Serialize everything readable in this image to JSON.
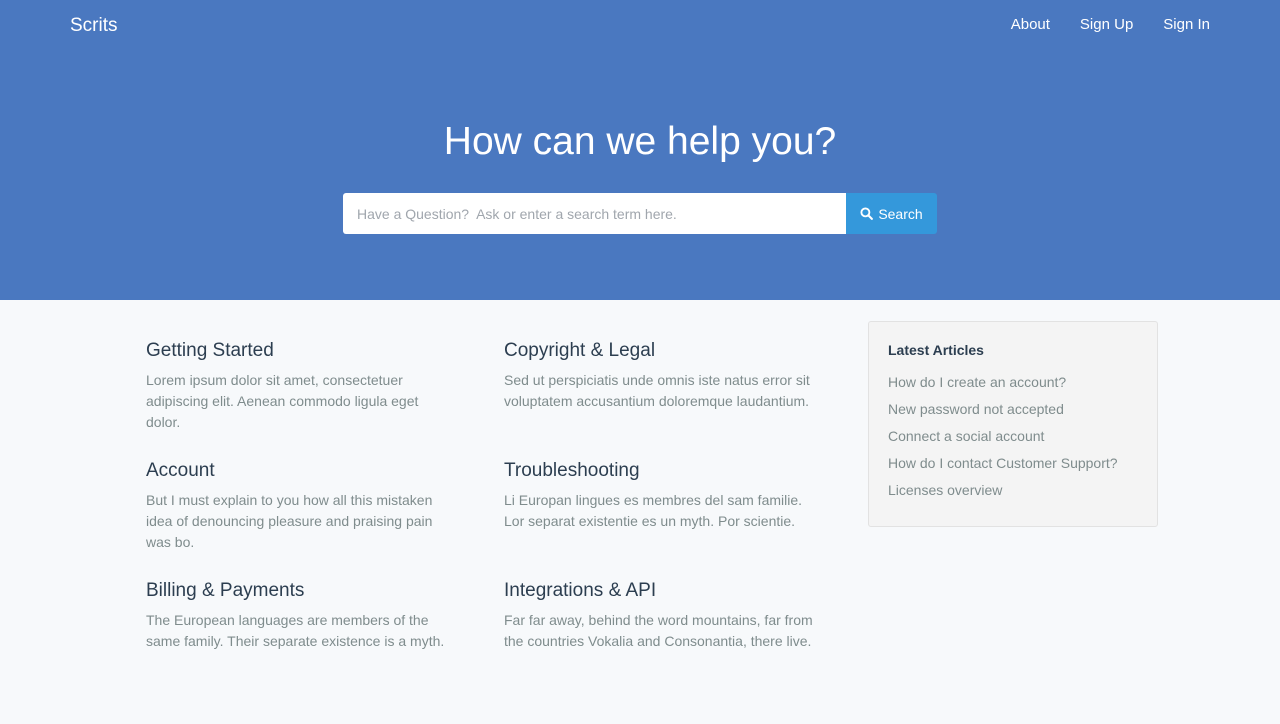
{
  "nav": {
    "brand": "Scrits",
    "links": [
      "About",
      "Sign Up",
      "Sign In"
    ]
  },
  "hero": {
    "title": "How can we help you?",
    "search_placeholder": "Have a Question?  Ask or enter a search term here.",
    "search_button": "Search",
    "search_icon": "search-icon"
  },
  "topics": [
    {
      "title": "Getting Started",
      "description": "Lorem ipsum dolor sit amet, consectetuer adipiscing elit. Aenean commodo ligula eget dolor."
    },
    {
      "title": "Copyright & Legal",
      "description": "Sed ut perspiciatis unde omnis iste natus error sit voluptatem accusantium doloremque laudantium."
    },
    {
      "title": "Account",
      "description": "But I must explain to you how all this mistaken idea of denouncing pleasure and praising pain was bo."
    },
    {
      "title": "Troubleshooting",
      "description": "Li Europan lingues es membres del sam familie. Lor separat existentie es un myth. Por scientie."
    },
    {
      "title": "Billing & Payments",
      "description": "The European languages are members of the same family. Their separate existence is a myth."
    },
    {
      "title": "Integrations & API",
      "description": "Far far away, behind the word mountains, far from the countries Vokalia and Consonantia, there live."
    }
  ],
  "sidebar": {
    "title": "Latest Articles",
    "articles": [
      "How do I create an account?",
      "New password not accepted",
      "Connect a social account",
      "How do I contact Customer Support?",
      "Licenses overview"
    ]
  },
  "colors": {
    "hero_bg": "#4a78c0",
    "search_button": "#3498db",
    "page_bg": "#f7f9fb",
    "heading_text": "#2c3e50",
    "muted_text": "#7f8c8d"
  }
}
